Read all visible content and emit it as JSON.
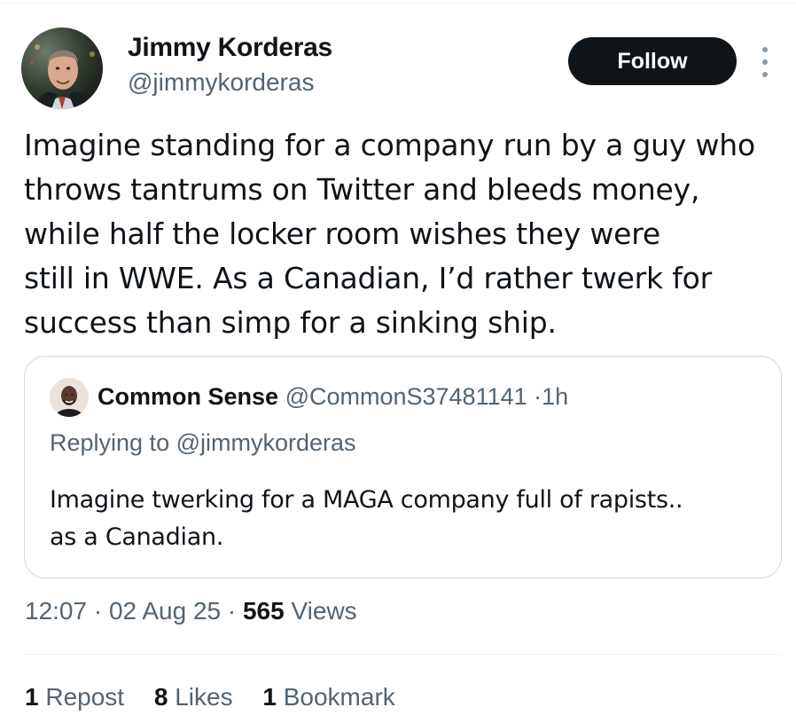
{
  "tweet": {
    "author": {
      "name": "Jimmy Korderas",
      "handle": "@jimmykorderas"
    },
    "follow_label": "Follow",
    "text_lines": [
      "Imagine standing for a company run by a guy who",
      "throws tantrums on Twitter and bleeds money,",
      "while half the locker room wishes they were",
      "still in WWE. As a Canadian, I’d rather twerk for",
      "success than simp for a sinking ship."
    ],
    "quoted": {
      "name": "Common Sense",
      "handle": "@CommonS37481141",
      "separator": "·",
      "age": "1h",
      "replying_to": "Replying to @jimmykorderas",
      "text_lines": [
        "Imagine twerking for a MAGA company full of rapists..",
        "as a Canadian."
      ]
    },
    "meta": {
      "time": "12:07",
      "separator": "·",
      "date": "02 Aug 25",
      "views_count": "565",
      "views_label": "Views"
    },
    "stats": {
      "reposts_count": "1",
      "reposts_label": "Repost",
      "likes_count": "8",
      "likes_label": "Likes",
      "bookmarks_count": "1",
      "bookmarks_label": "Bookmark"
    }
  },
  "icons": {
    "more": "more-vertical-icon"
  },
  "colors": {
    "text_primary": "#0f1419",
    "text_secondary": "#536471",
    "follow_button_bg": "#0f1419",
    "border": "#cfd9de"
  }
}
